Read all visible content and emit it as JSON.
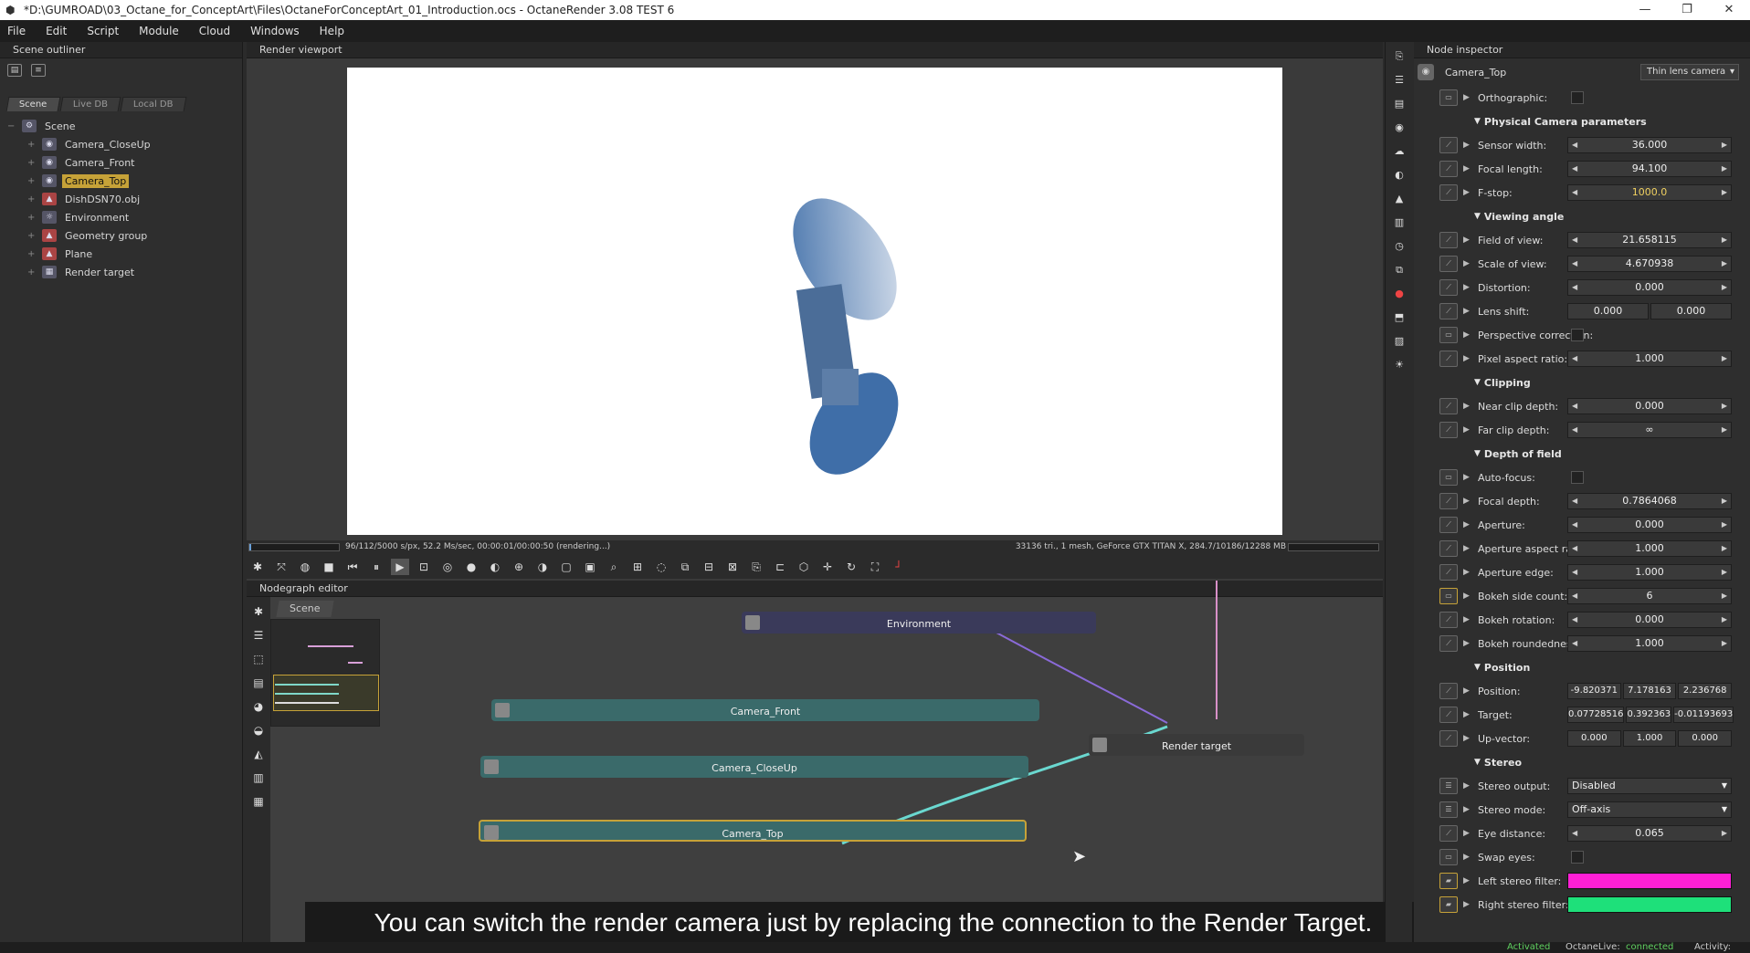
{
  "window": {
    "title": "*D:\\GUMROAD\\03_Octane_for_ConceptArt\\Files\\OctaneForConceptArt_01_Introduction.ocs - OctaneRender 3.08 TEST 6",
    "controls": [
      "—",
      "❐",
      "✕"
    ]
  },
  "menu": [
    "File",
    "Edit",
    "Script",
    "Module",
    "Cloud",
    "Windows",
    "Help"
  ],
  "outliner": {
    "header": "Scene outliner",
    "tabs": [
      "Scene",
      "Live DB",
      "Local DB"
    ],
    "root": "Scene",
    "items": [
      {
        "label": "Camera_CloseUp",
        "icon": "camera-icon",
        "selected": false
      },
      {
        "label": "Camera_Front",
        "icon": "camera-icon",
        "selected": false
      },
      {
        "label": "Camera_Top",
        "icon": "camera-icon",
        "selected": true
      },
      {
        "label": "DishDSN70.obj",
        "icon": "mesh-icon",
        "selected": false
      },
      {
        "label": "Environment",
        "icon": "environment-icon",
        "selected": false
      },
      {
        "label": "Geometry group",
        "icon": "group-icon",
        "selected": false
      },
      {
        "label": "Plane",
        "icon": "mesh-icon",
        "selected": false
      },
      {
        "label": "Render target",
        "icon": "render-target-icon",
        "selected": false
      }
    ]
  },
  "viewport": {
    "header": "Render viewport",
    "status_left": "96/112/5000 s/px, 52.2 Ms/sec, 00:00:01/00:00:50 (rendering...)",
    "status_right": "33136 tri., 1 mesh, GeForce GTX TITAN X, 284.7/10186/12288 MB",
    "progress": 0.02
  },
  "nodegraph": {
    "header": "Nodegraph editor",
    "tab": "Scene",
    "nodes": {
      "environment": "Environment",
      "camera_front": "Camera_Front",
      "camera_closeup": "Camera_CloseUp",
      "camera_top": "Camera_Top",
      "render_target": "Render target"
    }
  },
  "subtitle": "You can switch the render camera just by replacing the connection to the Render Target.",
  "inspector": {
    "header": "Node inspector",
    "node_name": "Camera_Top",
    "camera_type": "Thin lens camera",
    "orthographic_label": "Orthographic:",
    "sections": {
      "physical": "Physical Camera parameters",
      "viewing": "Viewing angle",
      "clipping": "Clipping",
      "dof": "Depth of field",
      "position": "Position",
      "stereo": "Stereo"
    },
    "params": {
      "sensor_width": {
        "label": "Sensor width:",
        "value": "36.000"
      },
      "focal_length": {
        "label": "Focal length:",
        "value": "94.100"
      },
      "fstop": {
        "label": "F-stop:",
        "value": "1000.0"
      },
      "fov": {
        "label": "Field of view:",
        "value": "21.658115"
      },
      "scale_of_view": {
        "label": "Scale of view:",
        "value": "4.670938"
      },
      "distortion": {
        "label": "Distortion:",
        "value": "0.000"
      },
      "lens_shift": {
        "label": "Lens shift:",
        "x": "0.000",
        "y": "0.000"
      },
      "perspective_correction": {
        "label": "Perspective correction:"
      },
      "pixel_aspect": {
        "label": "Pixel aspect ratio:",
        "value": "1.000"
      },
      "near_clip": {
        "label": "Near clip depth:",
        "value": "0.000"
      },
      "far_clip": {
        "label": "Far clip depth:",
        "value": "∞"
      },
      "autofocus": {
        "label": "Auto-focus:"
      },
      "focal_depth": {
        "label": "Focal depth:",
        "value": "0.7864068"
      },
      "aperture": {
        "label": "Aperture:",
        "value": "0.000"
      },
      "aperture_aspect": {
        "label": "Aperture aspect ratio:",
        "value": "1.000"
      },
      "aperture_edge": {
        "label": "Aperture edge:",
        "value": "1.000"
      },
      "bokeh_side_count": {
        "label": "Bokeh side count:",
        "value": "6"
      },
      "bokeh_rotation": {
        "label": "Bokeh rotation:",
        "value": "0.000"
      },
      "bokeh_roundedness": {
        "label": "Bokeh roundedness:",
        "value": "1.000"
      },
      "position": {
        "label": "Position:",
        "x": "-9.820371",
        "y": "7.178163",
        "z": "2.236768"
      },
      "target": {
        "label": "Target:",
        "x": "0.07728516",
        "y": "0.392363",
        "z": "-0.01193693"
      },
      "up_vector": {
        "label": "Up-vector:",
        "x": "0.000",
        "y": "1.000",
        "z": "0.000"
      },
      "stereo_output": {
        "label": "Stereo output:",
        "value": "Disabled"
      },
      "stereo_mode": {
        "label": "Stereo mode:",
        "value": "Off-axis"
      },
      "eye_distance": {
        "label": "Eye distance:",
        "value": "0.065"
      },
      "swap_eyes": {
        "label": "Swap eyes:"
      },
      "left_filter": {
        "label": "Left stereo filter:",
        "color": "#ff1fd6"
      },
      "right_filter": {
        "label": "Right stereo filter:",
        "color": "#1ee07a"
      }
    }
  },
  "statusbar": {
    "activated": "Activated",
    "octanelive_label": "OctaneLive:",
    "octanelive_value": "connected",
    "activity": "Activity:"
  }
}
